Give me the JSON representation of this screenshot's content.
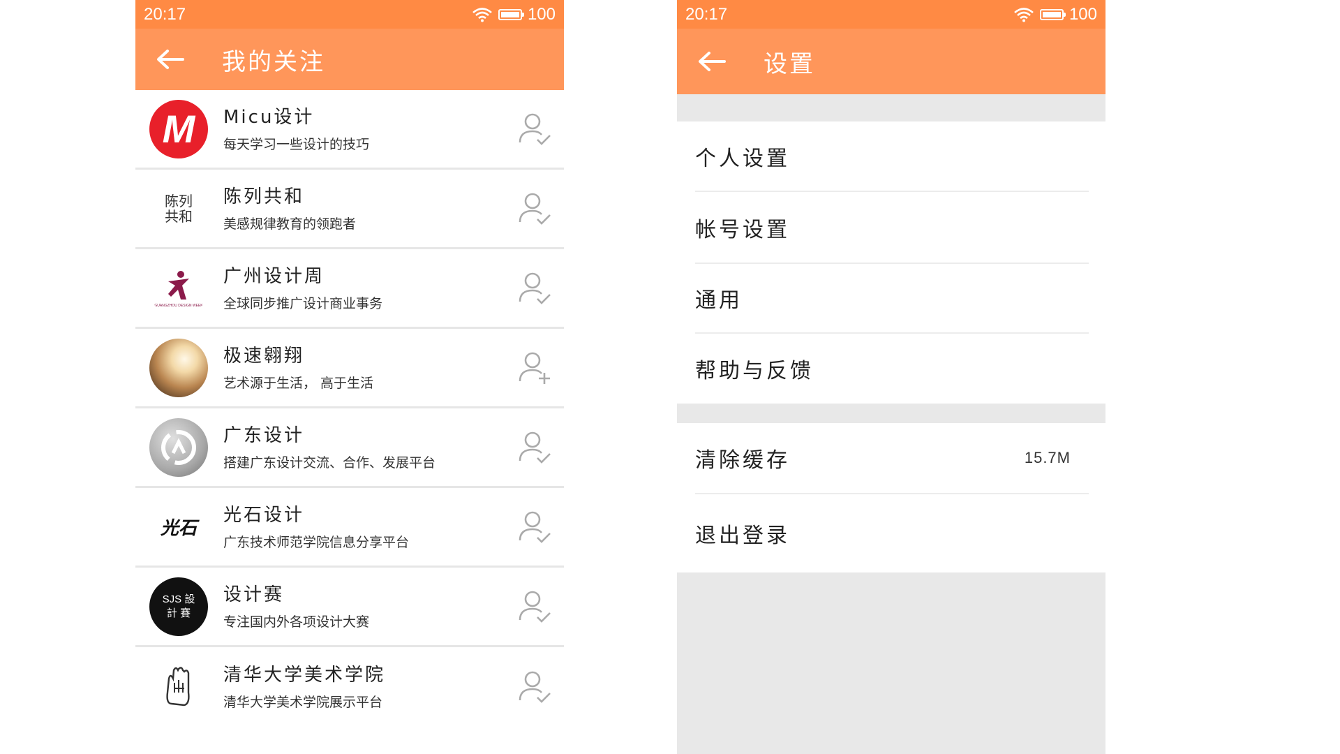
{
  "left_screen": {
    "status": {
      "time": "20:17",
      "battery": "100"
    },
    "title": "我的关注",
    "items": [
      {
        "name": "Micu设计",
        "desc": "每天学习一些设计的技巧",
        "followed": true,
        "avatar_text": "M"
      },
      {
        "name": "陈列共和",
        "desc": "美感规律教育的领跑者",
        "followed": true,
        "avatar_text": "陈列共和"
      },
      {
        "name": "广州设计周",
        "desc": "全球同步推广设计商业事务",
        "followed": true,
        "avatar_text": "GUANGZHOU DESIGN WEEK"
      },
      {
        "name": "极速翱翔",
        "desc": "艺术源于生活， 高于生活",
        "followed": false
      },
      {
        "name": "广东设计",
        "desc": "搭建广东设计交流、合作、发展平台",
        "followed": true
      },
      {
        "name": "光石设计",
        "desc": "广东技术师范学院信息分享平台",
        "followed": true,
        "avatar_text": "光石"
      },
      {
        "name": "设计赛",
        "desc": "专注国内外各项设计大赛",
        "followed": true,
        "avatar_text": "SJS 設 計 賽"
      },
      {
        "name": "清华大学美术学院",
        "desc": "清华大学美术学院展示平台",
        "followed": true
      }
    ]
  },
  "right_screen": {
    "status": {
      "time": "20:17",
      "battery": "100"
    },
    "title": "设置",
    "group1": [
      {
        "label": "个人设置"
      },
      {
        "label": "帐号设置"
      },
      {
        "label": "通用"
      },
      {
        "label": "帮助与反馈"
      }
    ],
    "group2": [
      {
        "label": "清除缓存",
        "value": "15.7M"
      },
      {
        "label": "退出登录"
      }
    ]
  },
  "colors": {
    "status_bar": "#ff8a44",
    "title_bar": "#ff965a",
    "background_gray": "#e8e8e8"
  },
  "icons": {
    "back": "arrow-left-icon",
    "followed": "user-check-icon",
    "not_followed": "user-plus-icon",
    "wifi": "wifi-icon",
    "battery": "battery-icon"
  }
}
